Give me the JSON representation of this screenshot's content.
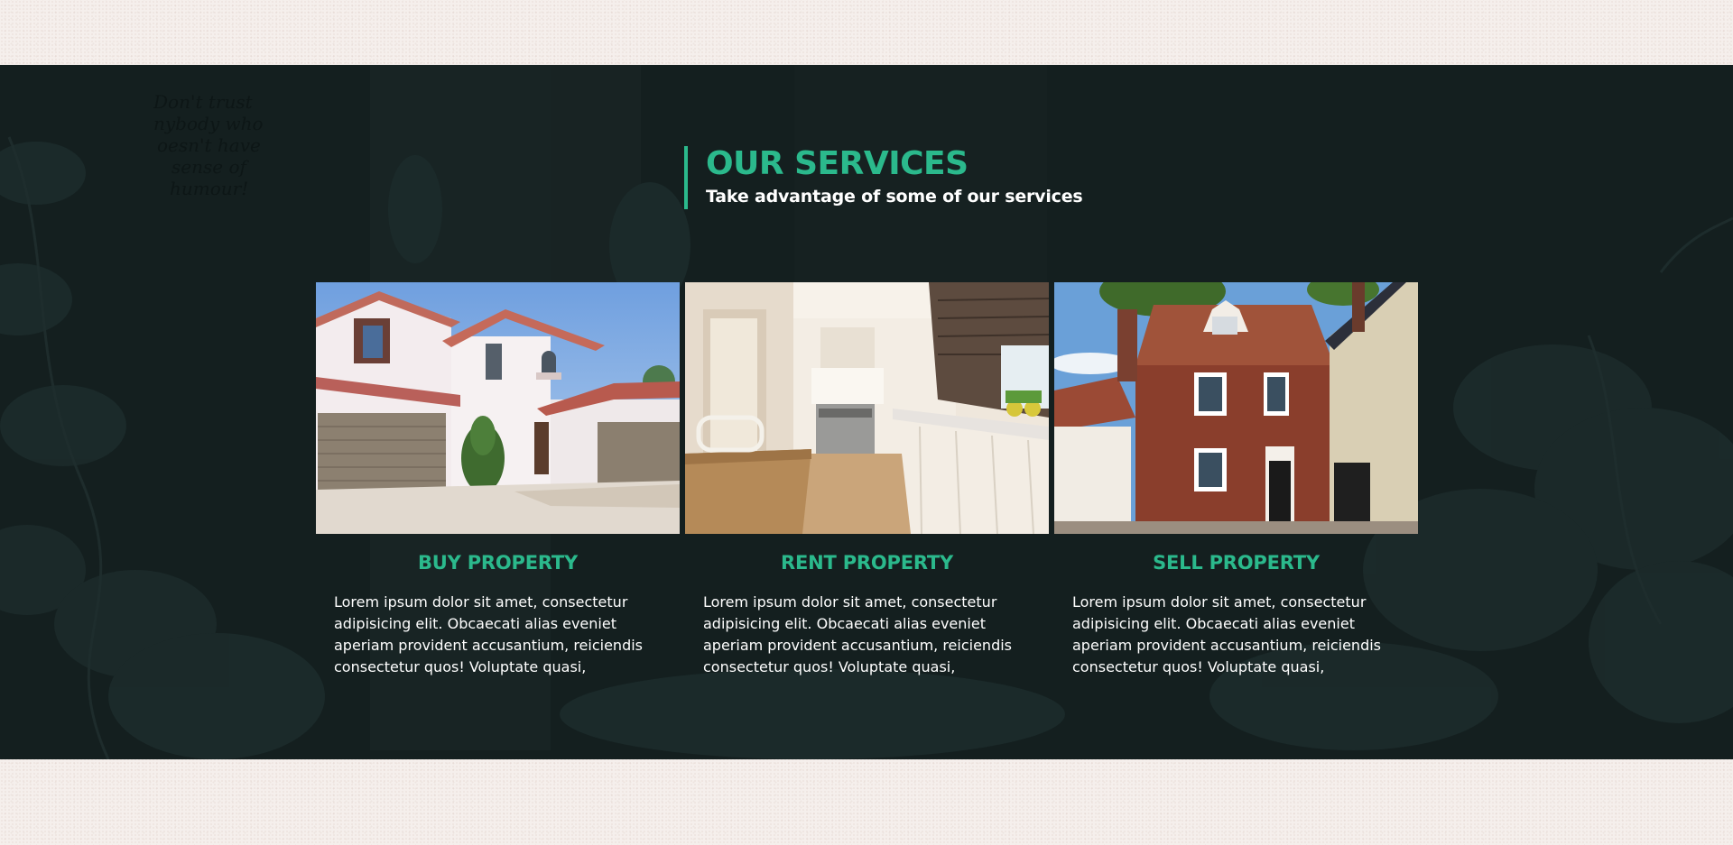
{
  "section": {
    "title": "OUR SERVICES",
    "subtitle": "Take advantage of some of our services"
  },
  "services": [
    {
      "title": "BUY PROPERTY",
      "description": "Lorem ipsum dolor sit amet, consectetur adipisicing elit. Obcaecati alias eveniet aperiam provident accusantium, reiciendis consectetur quos! Voluptate quasi,",
      "image": "white-villa-with-garages"
    },
    {
      "title": "RENT PROPERTY",
      "description": "Lorem ipsum dolor sit amet, consectetur adipisicing elit. Obcaecati alias eveniet aperiam provident accusantium, reiciendis consectetur quos! Voluptate quasi,",
      "image": "bright-kitchen-interior"
    },
    {
      "title": "SELL PROPERTY",
      "description": "Lorem ipsum dolor sit amet, consectetur adipisicing elit. Obcaecati alias eveniet aperiam provident accusantium, reiciendis consectetur quos! Voluptate quasi,",
      "image": "brick-townhouse"
    }
  ],
  "background_art": {
    "handwritten_note": "Don't trust anybody who doesn't have a sense of humour!"
  },
  "colors": {
    "accent": "#2bb98c",
    "section_bg": "#141f1f",
    "page_bg": "#f5efec",
    "text": "#ffffff"
  }
}
